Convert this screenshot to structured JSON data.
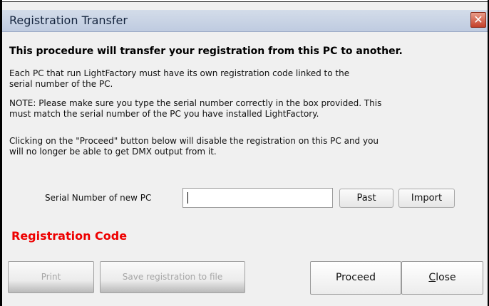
{
  "window": {
    "title": "Registration Transfer"
  },
  "intro": "This procedure will transfer your registration from this PC to another.",
  "paragraphs": {
    "p1_line1": "Each PC that run LightFactory must have its own registration code linked to the",
    "p1_line2": "serial number of the PC.",
    "p2_line1": "NOTE: Please make sure you type the serial number correctly in the box provided. This",
    "p2_line2": "must match the serial number of the PC you have installed LightFactory.",
    "p3_line1": "Clicking on the \"Proceed\" button below will disable the registration on this PC and you",
    "p3_line2": "will no longer be able to get DMX output from it."
  },
  "serial": {
    "label": "Serial Number of new PC",
    "value": ""
  },
  "buttons": {
    "past": "Past",
    "import": "Import",
    "print": "Print",
    "save": "Save registration to file",
    "proceed": "Proceed",
    "close_first": "C",
    "close_rest": "lose"
  },
  "registration_code_label": "Registration Code",
  "colors": {
    "registration_code": "#ee0000",
    "titlebar": "#c7d2e4"
  }
}
